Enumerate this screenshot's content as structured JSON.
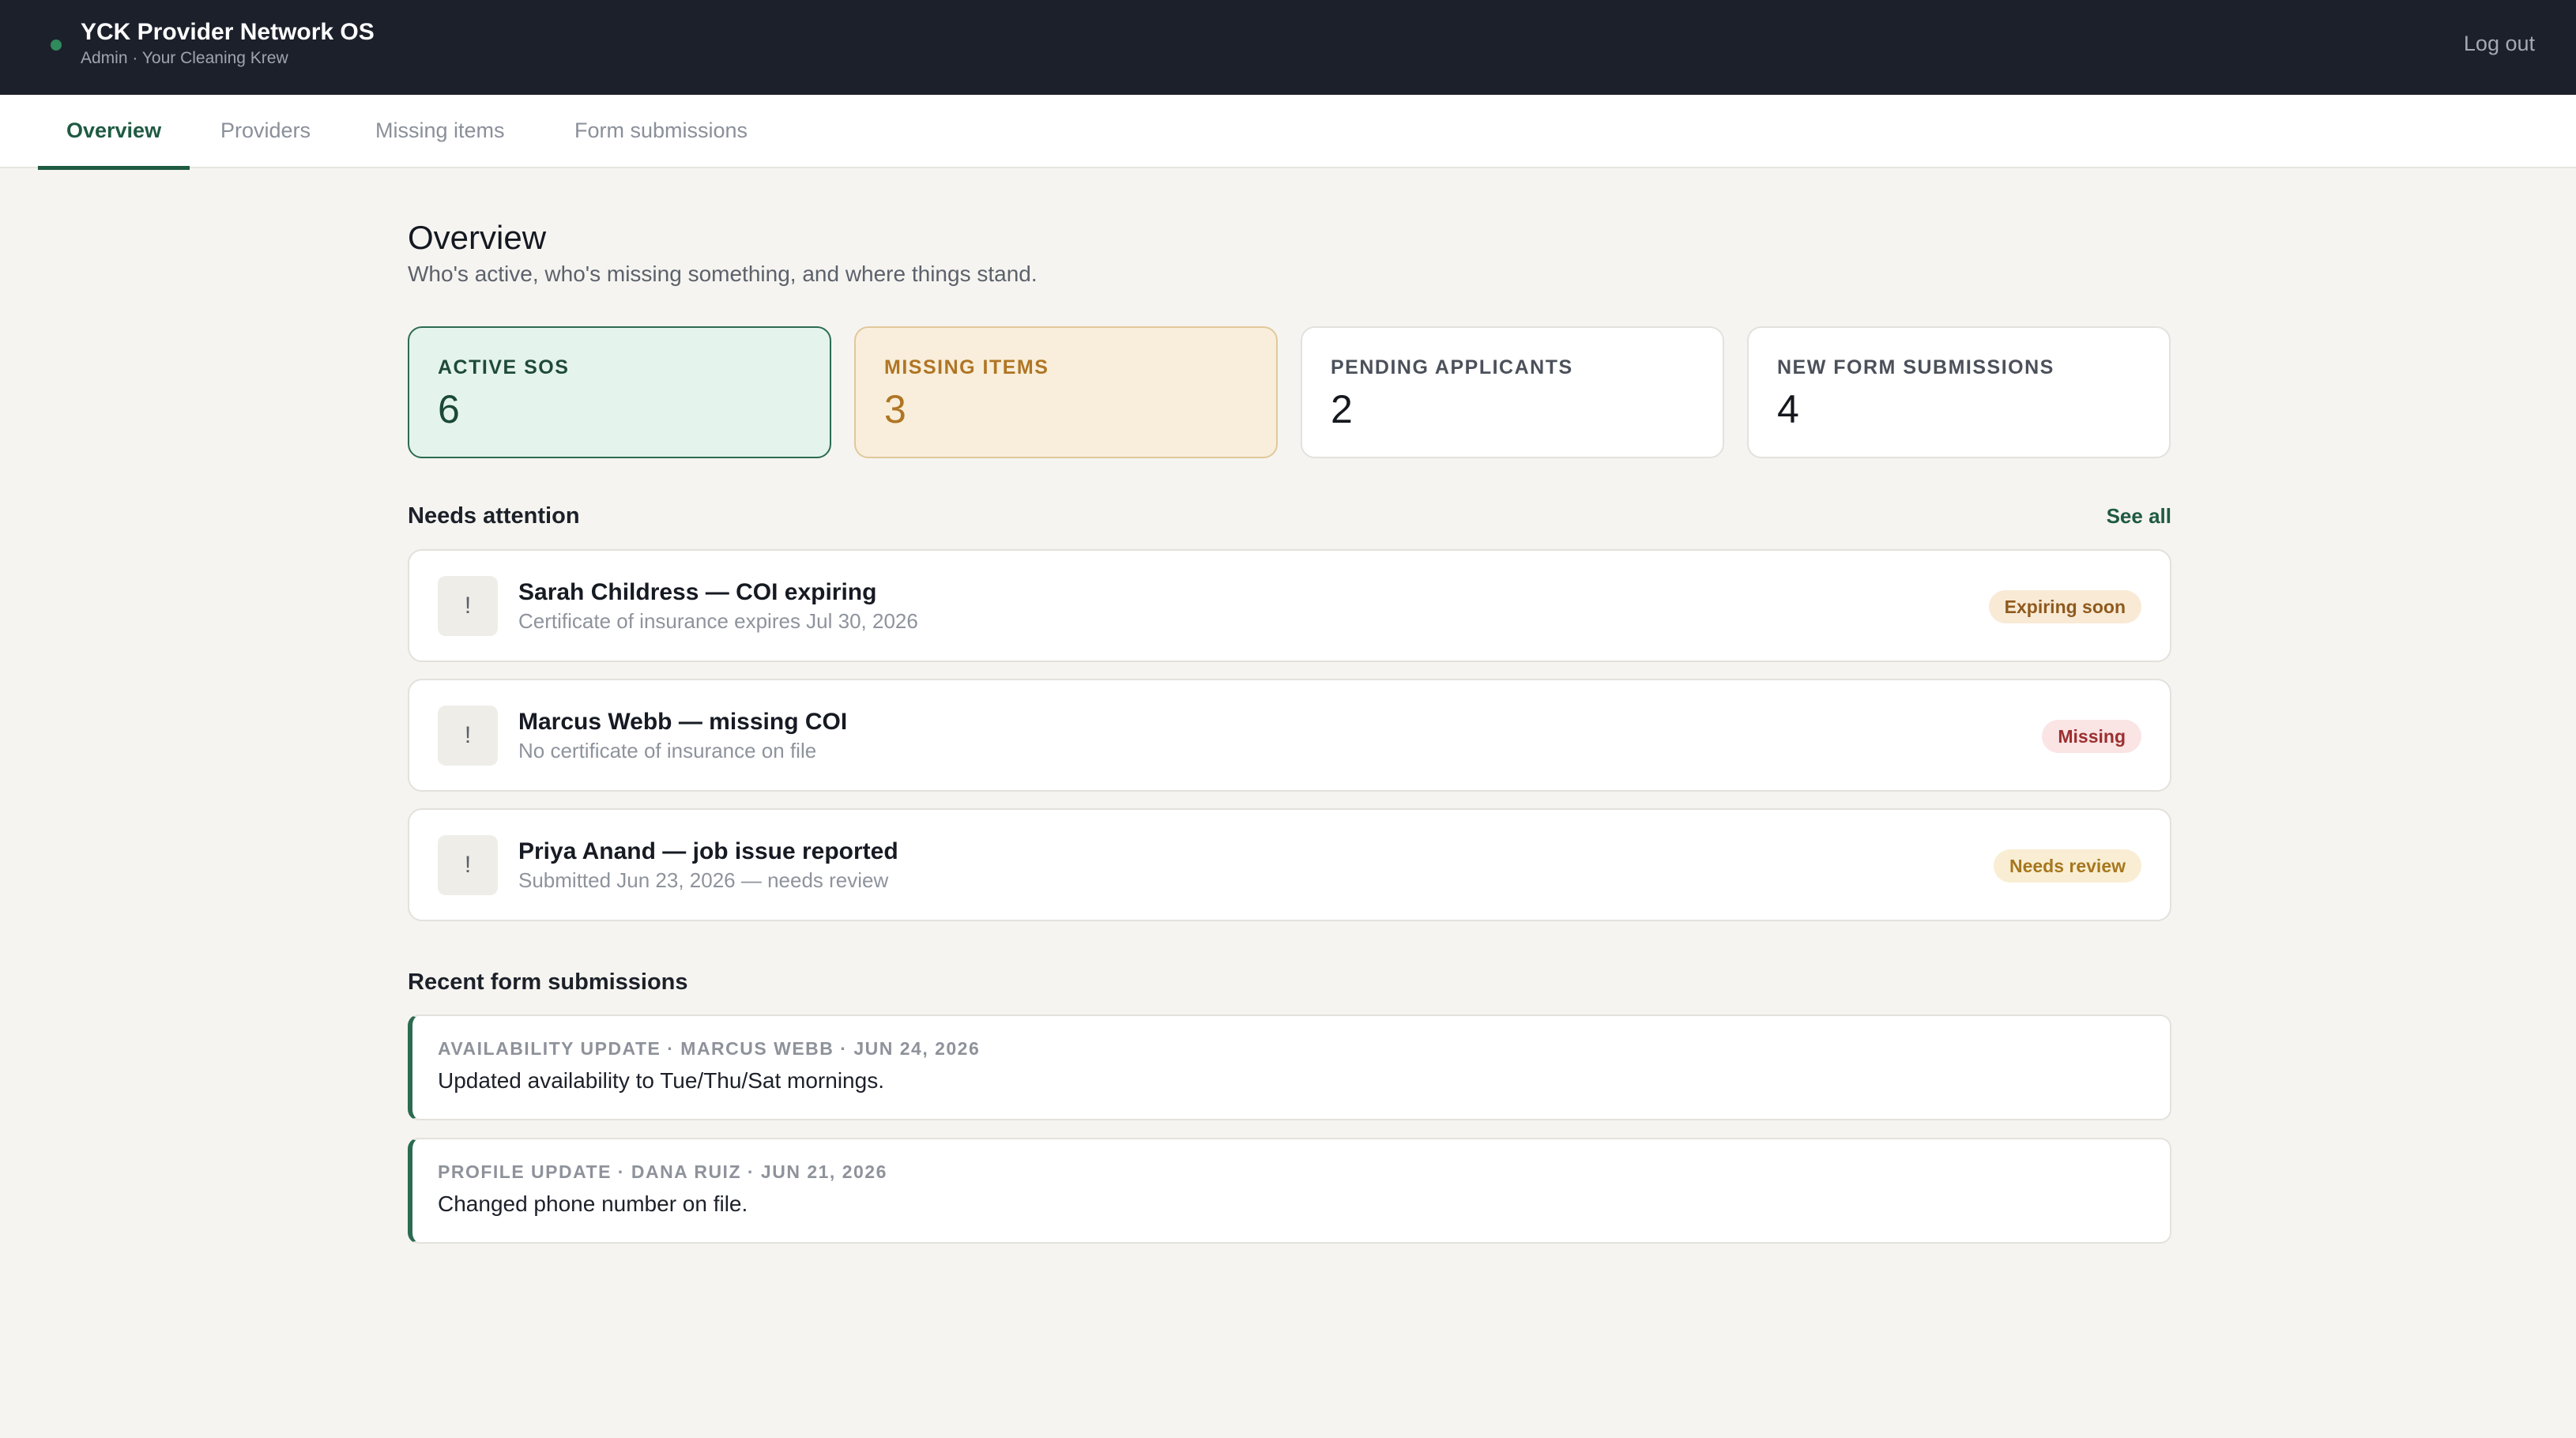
{
  "header": {
    "title": "YCK Provider Network OS",
    "subtitle": "Admin · Your Cleaning Krew",
    "logout_label": "Log out",
    "status_color": "#2f8a5c"
  },
  "tabs": [
    {
      "label": "Overview",
      "active": true
    },
    {
      "label": "Providers",
      "active": false
    },
    {
      "label": "Missing items",
      "active": false
    },
    {
      "label": "Form submissions",
      "active": false
    }
  ],
  "overview": {
    "title": "Overview",
    "description": "Who's active, who's missing something, and where things stand."
  },
  "stats": [
    {
      "label": "ACTIVE SOS",
      "value": "6",
      "accent": "#2c6b52"
    },
    {
      "label": "MISSING ITEMS",
      "value": "3",
      "accent": "#b07524"
    },
    {
      "label": "PENDING APPLICANTS",
      "value": "2"
    },
    {
      "label": "NEW FORM SUBMISSIONS",
      "value": "4"
    }
  ],
  "needs_attention": {
    "title": "Needs attention",
    "see_all_label": "See all",
    "icon": "exclamation-icon",
    "icon_glyph": "!",
    "items": [
      {
        "title": "Sarah Childress — COI expiring",
        "subtitle": "Certificate of insurance expires Jul 30, 2026",
        "badge": "Expiring soon",
        "badge_color": "#8e5a1e"
      },
      {
        "title": "Marcus Webb — missing COI",
        "subtitle": "No certificate of insurance on file",
        "badge": "Missing",
        "badge_color": "#9c2f2f"
      },
      {
        "title": "Priya Anand — job issue reported",
        "subtitle": "Submitted Jun 23, 2026 — needs review",
        "badge": "Needs review",
        "badge_color": "#a7771e"
      }
    ]
  },
  "recent_submissions": {
    "title": "Recent form submissions",
    "items": [
      {
        "meta": "AVAILABILITY UPDATE · MARCUS WEBB · JUN 24, 2026",
        "text": "Updated availability to Tue/Thu/Sat mornings."
      },
      {
        "meta": "PROFILE UPDATE · DANA RUIZ · JUN 21, 2026",
        "text": "Changed phone number on file."
      }
    ]
  }
}
